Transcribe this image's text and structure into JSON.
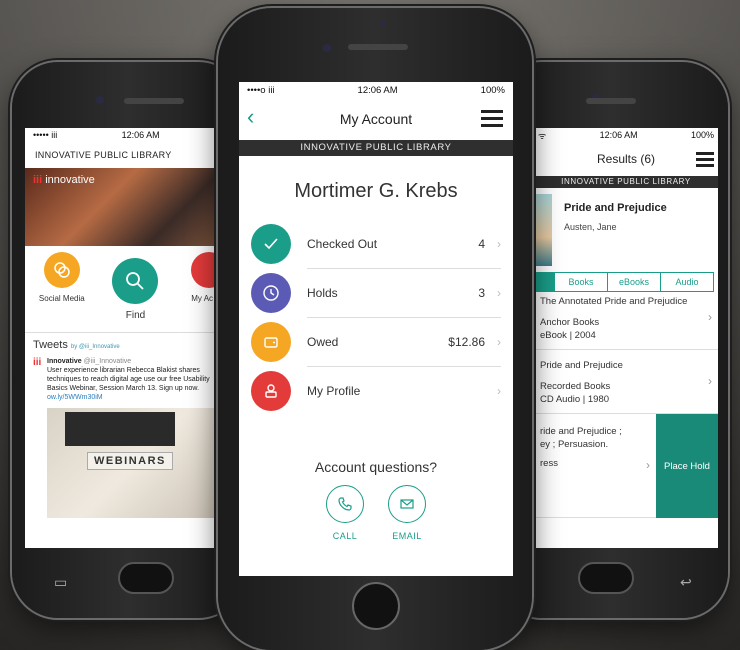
{
  "left": {
    "status": {
      "time": "12:06 AM",
      "signal": "••••• iii"
    },
    "library": "INNOVATIVE PUBLIC LIBRARY",
    "brand": "innovative",
    "quick": [
      {
        "label": "Social Media",
        "color": "#f5a623"
      },
      {
        "label": "Find",
        "color": "#1a9e8a"
      },
      {
        "label": "My Ac",
        "color": "#e33a3a"
      }
    ],
    "tweets": {
      "title": "Tweets",
      "by": "by @iii_Innovative",
      "author": "Innovative",
      "handle": "@iii_Innovative",
      "body": "User experience librarian Rebecca Blakist shares techniques to reach digital age use our free Usability Basics Webinar, Session March 13. Sign up now.",
      "link": "ow.ly/5WWm30iM",
      "image_label": "WEBINARS"
    }
  },
  "center": {
    "status": {
      "signal": "••••o iii",
      "time": "12:06 AM",
      "battery": "100%"
    },
    "title": "My Account",
    "library": "INNOVATIVE PUBLIC LIBRARY",
    "patron": "Mortimer G. Krebs",
    "items": [
      {
        "label": "Checked Out",
        "value": "4",
        "color": "#1a9e8a",
        "icon": "check-icon"
      },
      {
        "label": "Holds",
        "value": "3",
        "color": "#5b5bb5",
        "icon": "clock-icon"
      },
      {
        "label": "Owed",
        "value": "$12.86",
        "color": "#f5a623",
        "icon": "wallet-icon"
      },
      {
        "label": "My Profile",
        "value": "",
        "color": "#e33a3a",
        "icon": "person-icon"
      }
    ],
    "questions": "Account questions?",
    "call": "CALL",
    "email": "EMAIL"
  },
  "right": {
    "status": {
      "time": "12:06 AM",
      "battery": "100%"
    },
    "title": "Results (6)",
    "library": "INNOVATIVE PUBLIC LIBRARY",
    "book": {
      "title": "Pride and Prejudice",
      "author": "Austen, Jane"
    },
    "formats": [
      "Books",
      "eBooks",
      "Audio"
    ],
    "results": [
      {
        "line1": "The Annotated Pride and Prejudice",
        "line2": "Anchor Books",
        "line3": "eBook | 2004"
      },
      {
        "line1": "Pride and Prejudice",
        "line2": "Recorded Books",
        "line3": "CD Audio | 1980"
      },
      {
        "line1": "ride and Prejudice ;",
        "line2": "ey ; Persuasion.",
        "line3": "ress"
      }
    ],
    "place_hold": "Place Hold"
  }
}
